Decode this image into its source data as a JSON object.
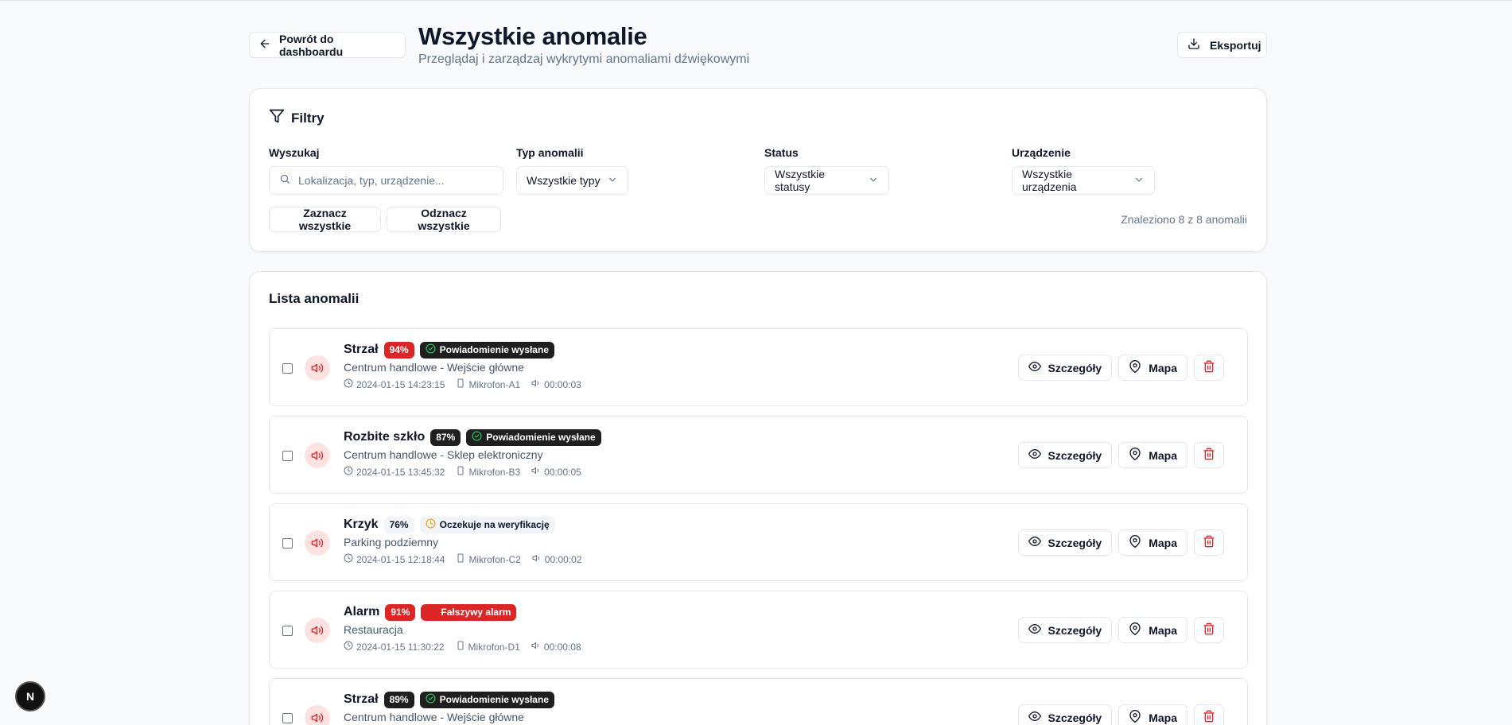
{
  "header": {
    "back_label": "Powrót do dashboardu",
    "title": "Wszystkie anomalie",
    "subtitle": "Przeglądaj i zarządzaj wykrytymi anomaliami dźwiękowymi",
    "export_label": "Eksportuj"
  },
  "filters": {
    "title": "Filtry",
    "search_label": "Wyszukaj",
    "search_placeholder": "Lokalizacja, typ, urządzenie...",
    "search_value": "",
    "type_label": "Typ anomalii",
    "type_value": "Wszystkie typy",
    "status_label": "Status",
    "status_value": "Wszystkie statusy",
    "device_label": "Urządzenie",
    "device_value": "Wszystkie urządzenia",
    "select_all": "Zaznacz wszystkie",
    "deselect_all": "Odznacz wszystkie",
    "found_text": "Znaleziono 8 z 8 anomalii"
  },
  "list": {
    "title": "Lista anomalii",
    "details_label": "Szczegóły",
    "map_label": "Mapa",
    "items": [
      {
        "type": "Strzał",
        "confidence": "94%",
        "status": "Powiadomienie wysłane",
        "location": "Centrum handlowe - Wejście główne",
        "time": "2024-01-15 14:23:15",
        "device": "Mikrofon-A1",
        "duration": "00:00:03"
      },
      {
        "type": "Rozbite szkło",
        "confidence": "87%",
        "status": "Powiadomienie wysłane",
        "location": "Centrum handlowe - Sklep elektroniczny",
        "time": "2024-01-15 13:45:32",
        "device": "Mikrofon-B3",
        "duration": "00:00:05"
      },
      {
        "type": "Krzyk",
        "confidence": "76%",
        "status": "Oczekuje na weryfikację",
        "location": "Parking podziemny",
        "time": "2024-01-15 12:18:44",
        "device": "Mikrofon-C2",
        "duration": "00:00:02"
      },
      {
        "type": "Alarm",
        "confidence": "91%",
        "status": "Fałszywy alarm",
        "location": "Restauracja",
        "time": "2024-01-15 11:30:22",
        "device": "Mikrofon-D1",
        "duration": "00:00:08"
      },
      {
        "type": "Strzał",
        "confidence": "89%",
        "status": "Powiadomienie wysłane",
        "location": "Centrum handlowe - Wejście główne",
        "time": "",
        "device": "",
        "duration": ""
      }
    ]
  },
  "dev_badge": "N",
  "colors": {
    "danger": "#dc2626",
    "dark_badge": "#1f1f1f",
    "pending_icon": "#f59e0b",
    "sent_icon": "#22c55e",
    "muted_text": "#64748b"
  }
}
